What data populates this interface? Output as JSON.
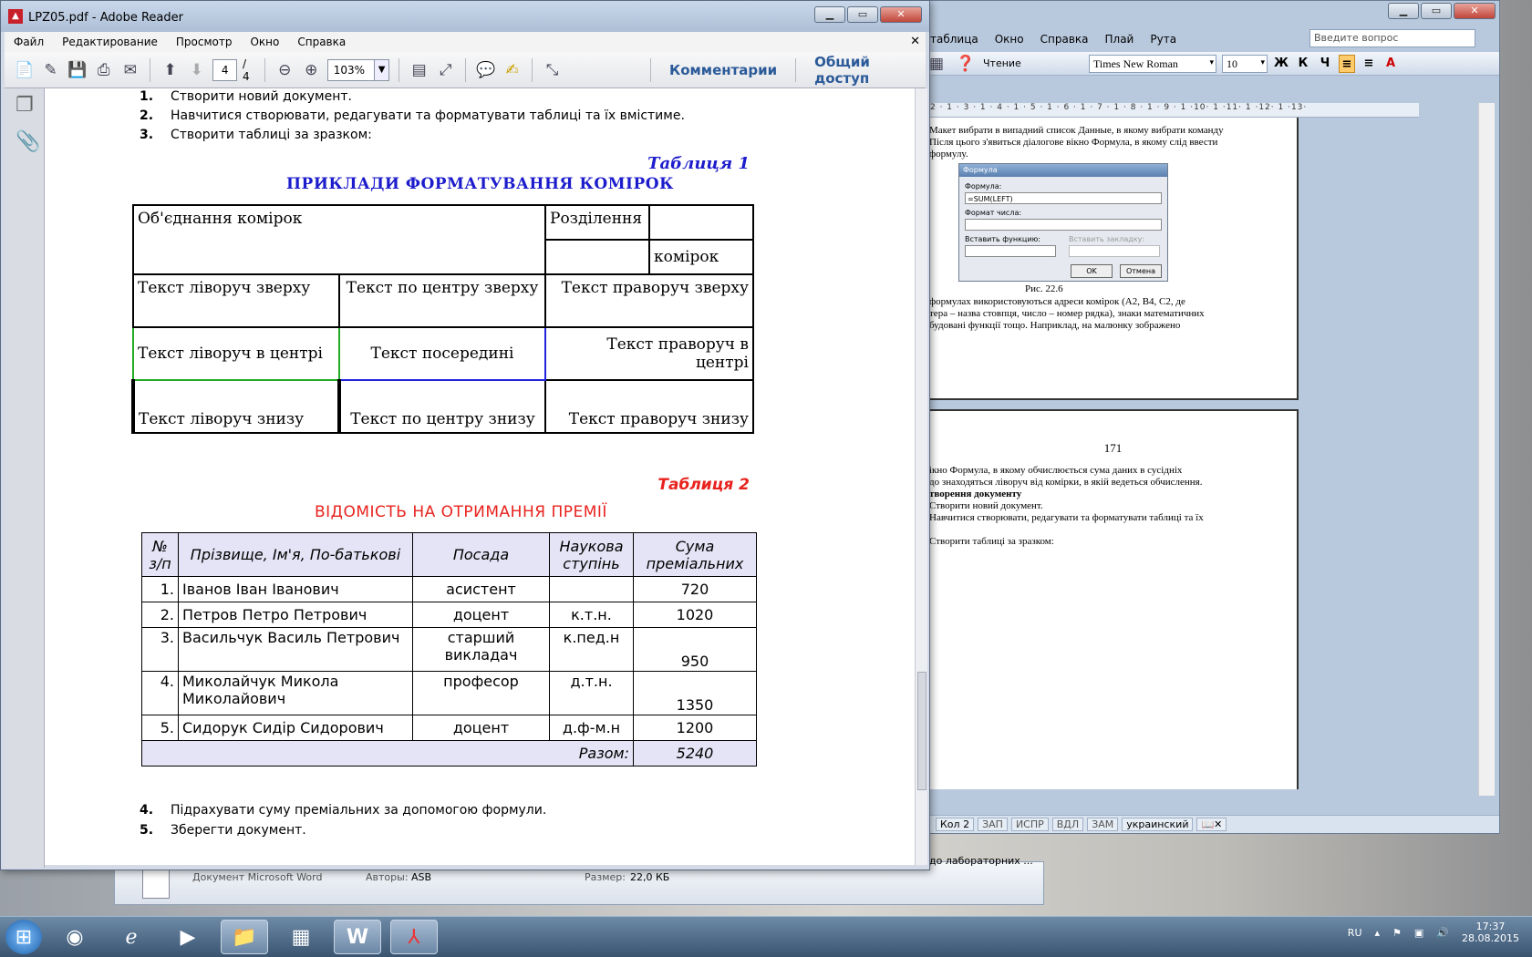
{
  "word": {
    "menu": [
      "таблица",
      "Окно",
      "Справка",
      "Плай",
      "Рута"
    ],
    "help_placeholder": "Введите вопрос",
    "view_label": "Чтение",
    "font": "Times New Roman",
    "size": "10",
    "ruler": "2 · 1 · 3 · 1 · 4 · 1 · 5 · 1 · 6 · 1 · 7 · 1 · 8 · 1 · 9 · 1 ·10· 1 ·11· 1 ·12· 1 ·13·",
    "page1_lines": [
      "Макет вибрати в випадний список Данные, в якому вибрати команду",
      "Після цього з'явиться діалогове вікно Формула, в якому слід ввести",
      "формулу."
    ],
    "figure_caption": "Рис.  22.6",
    "page1_lines2": [
      "формулах використовуються адреси комірок (A2, B4, C2, де",
      "тера – назва стовпця, число – номер рядка), знаки математичних",
      "будовані функції тощо. Наприклад, на малюнку зображено"
    ],
    "page_number": "171",
    "page2_lines": [
      "ікно Формула, в якому обчислюється сума даних в сусідніх",
      "до знаходяться ліворуч від комірки, в якій ведеться обчислення."
    ],
    "page2_bold": "творення документу",
    "page2_lines2": [
      "Створити новий документ.",
      "Навчитися створювати, редагувати та форматувати таблиці та їх",
      "",
      "Створити таблиці за зразком:"
    ],
    "dialog": {
      "title": "Формула",
      "formula_label": "Формула:",
      "formula_value": "=SUM(LEFT)",
      "format_label": "Формат числа:",
      "insert_fn": "Вставить функцию:",
      "insert_bm": "Вставить закладку:",
      "ok": "OK",
      "cancel": "Отмена"
    },
    "status": {
      "col": "Кол  2",
      "zap": "ЗАП",
      "ispr": "ИСПР",
      "vdl": "ВДЛ",
      "zam": "ЗАМ",
      "lang": "украинский"
    },
    "task_hint": "до лабораторних ..."
  },
  "explorer": {
    "type": "Документ Microsoft Word",
    "authors_label": "Авторы:",
    "authors": "ASB",
    "size_label": "Размер:",
    "size": "22,0 КБ"
  },
  "reader": {
    "title": "LPZ05.pdf - Adobe Reader",
    "menu": [
      "Файл",
      "Редактирование",
      "Просмотр",
      "Окно",
      "Справка"
    ],
    "page_current": "4",
    "page_total": "/ 4",
    "zoom": "103%",
    "comments": "Комментарии",
    "share": "Общий доступ"
  },
  "doc": {
    "list_top": [
      {
        "n": "1.",
        "t": "Створити новий документ."
      },
      {
        "n": "2.",
        "t": "Навчитися створювати, редагувати та форматувати таблиці та їх вмістиме."
      },
      {
        "n": "3.",
        "t": "Створити таблиці за зразком:"
      }
    ],
    "t1_caption": "Таблиця 1",
    "t1_title": "ПРИКЛАДИ ФОРМАТУВАННЯ КОМІРОК",
    "t1": {
      "merge": "Об'єднання комірок",
      "split": "Розділення",
      "cells": "комірок",
      "r1": [
        "Текст ліворуч зверху",
        "Текст по центру зверху",
        "Текст праворуч зверху"
      ],
      "r2": [
        "Текст ліворуч в центрі",
        "Текст посередині",
        "Текст праворуч в центрі"
      ],
      "r3": [
        "Текст ліворуч знизу",
        "Текст по центру знизу",
        "Текст праворуч знизу"
      ]
    },
    "t2_caption": "Таблиця 2",
    "t2_title": "ВІДОМІСТЬ НА ОТРИМАННЯ ПРЕМІЇ",
    "t2": {
      "headers": [
        "№ з/п",
        "Прізвище, Ім'я, По-батькові",
        "Посада",
        "Наукова ступінь",
        "Сума преміальних"
      ],
      "rows": [
        {
          "n": "1.",
          "name": "Іванов Іван Іванович",
          "pos": "асистент",
          "deg": "",
          "sum": "720"
        },
        {
          "n": "2.",
          "name": "Петров Петро Петрович",
          "pos": "доцент",
          "deg": "к.т.н.",
          "sum": "1020"
        },
        {
          "n": "3.",
          "name": "Васильчук Василь Петрович",
          "pos": "старший викладач",
          "deg": "к.пед.н",
          "sum": "950"
        },
        {
          "n": "4.",
          "name": "Миколайчук Микола Миколайович",
          "pos": "професор",
          "deg": "д.т.н.",
          "sum": "1350"
        },
        {
          "n": "5.",
          "name": "Сидорук Сидір Сидорович",
          "pos": "доцент",
          "deg": "д.ф-м.н",
          "sum": "1200"
        }
      ],
      "total_label": "Разом:",
      "total": "5240"
    },
    "list_bottom": [
      {
        "n": "4.",
        "t": "Підрахувати суму преміальних за допомогою формули."
      },
      {
        "n": "5.",
        "t": "Зберегти документ."
      }
    ]
  },
  "tray": {
    "lang": "RU",
    "time": "17:37",
    "date": "28.08.2015"
  },
  "colors": {
    "blue_title": "#1c1ccc",
    "red_title": "#e8231e",
    "green_border": "#22aa22",
    "blue_border": "#2222dd"
  }
}
